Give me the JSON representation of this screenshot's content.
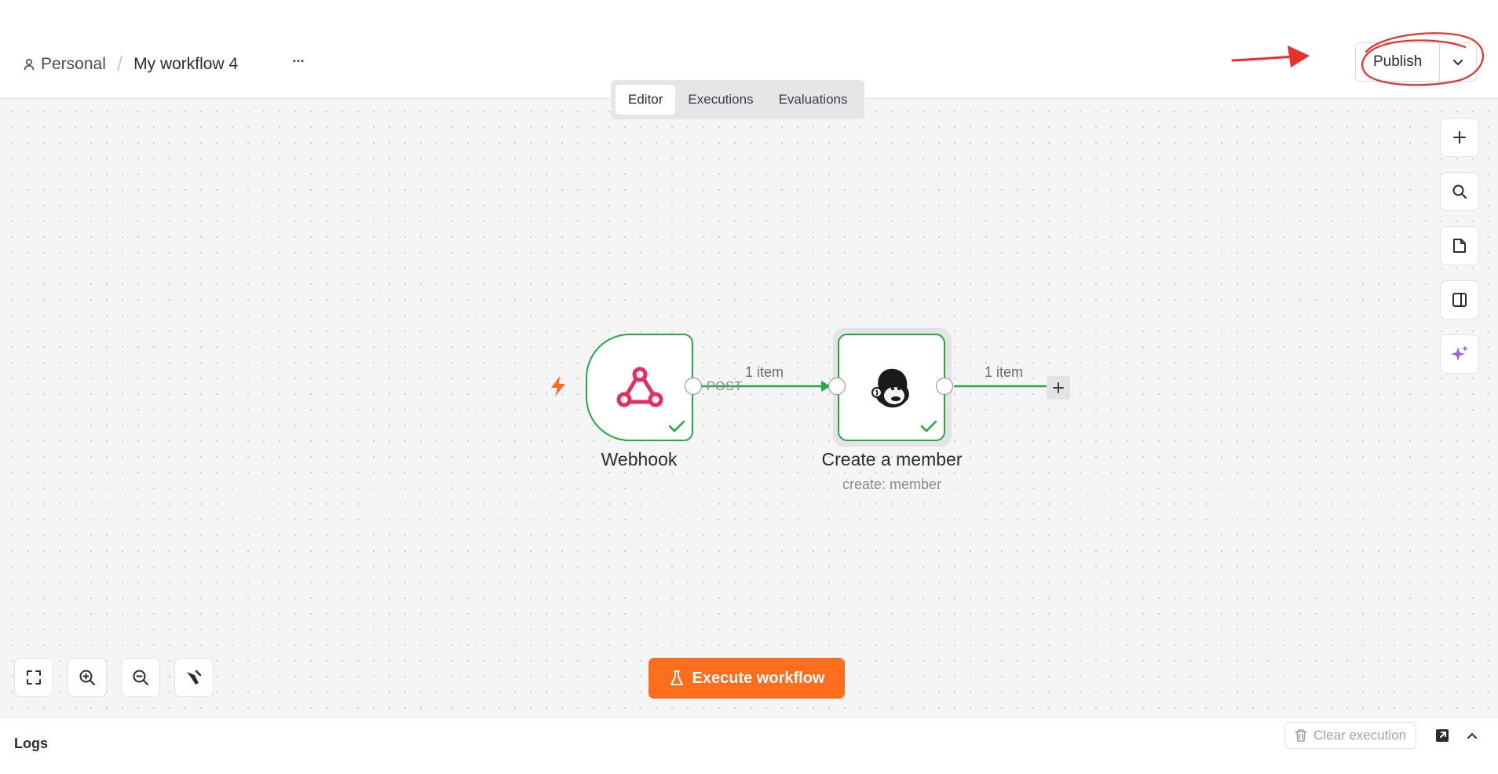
{
  "header": {
    "project": "Personal",
    "separator": "/",
    "workflow_name": "My workflow 4",
    "more_label": "···",
    "publish_label": "Publish"
  },
  "tabs": [
    {
      "label": "Editor",
      "active": true
    },
    {
      "label": "Executions",
      "active": false
    },
    {
      "label": "Evaluations",
      "active": false
    }
  ],
  "right_toolbar": [
    "plus-icon",
    "search-icon",
    "sticky-note-icon",
    "panel-icon",
    "ai-sparkle-icon"
  ],
  "bottom_toolbar": [
    "fit-view-icon",
    "zoom-in-icon",
    "zoom-out-icon",
    "tidy-up-icon"
  ],
  "nodes": {
    "webhook": {
      "label": "Webhook",
      "method": "POST",
      "icon": "webhook-icon",
      "status": "success"
    },
    "member": {
      "label": "Create a member",
      "subtitle": "create: member",
      "icon": "mailchimp-icon",
      "status": "success"
    }
  },
  "edges": {
    "webhook_to_member": "1 item",
    "member_out": "1 item"
  },
  "execute": {
    "label": "Execute workflow"
  },
  "logs": {
    "title": "Logs",
    "clear_label": "Clear execution"
  },
  "colors": {
    "accent": "#ff6d1f",
    "success": "#29a745",
    "annotation": "#e8302c",
    "ai": "#9b5de5",
    "webhook": "#e0315e"
  }
}
